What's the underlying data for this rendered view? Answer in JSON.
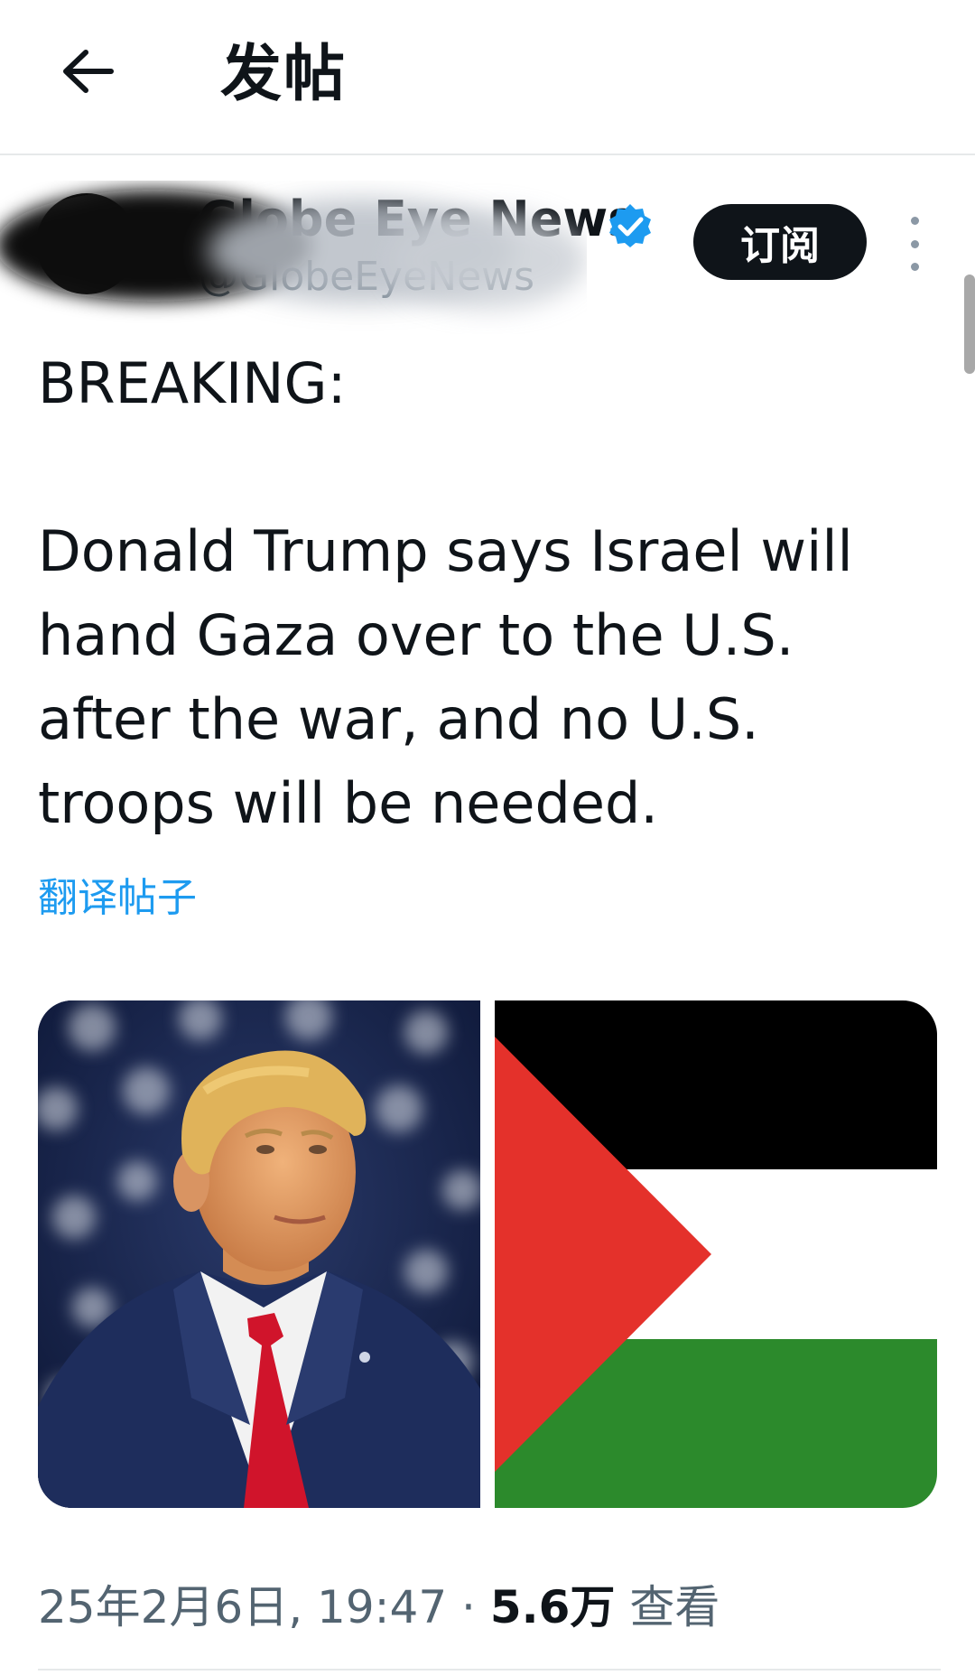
{
  "header": {
    "back_icon": "arrow-left-icon",
    "title": "发帖"
  },
  "author": {
    "display_name": "Globe Eye News",
    "handle": "@GlobeEyeNews",
    "verified_icon": "verified-badge-icon",
    "verified_color": "#1d9bf0",
    "subscribe_label": "订阅",
    "more_icon": "more-vertical-icon"
  },
  "tweet": {
    "text": "BREAKING:\n\nDonald Trump says Israel will hand Gaza over to the U.S. after the war, and no U.S. troops will be needed.",
    "translate_label": "翻译帖子",
    "media": [
      {
        "kind": "photo",
        "subject": "portrait of man in suit with red tie"
      },
      {
        "kind": "photo",
        "subject": "palestinian-flag"
      }
    ]
  },
  "meta": {
    "timestamp": "25年2月6日, 19:47",
    "separator": "·",
    "view_count": "5.6万",
    "view_label": "查看"
  },
  "colors": {
    "accent": "#1d9bf0",
    "text": "#0f1419",
    "muted": "#536471",
    "flag_red": "#e4312b",
    "flag_black": "#000000",
    "flag_white": "#ffffff",
    "flag_green": "#2c8a2c"
  }
}
